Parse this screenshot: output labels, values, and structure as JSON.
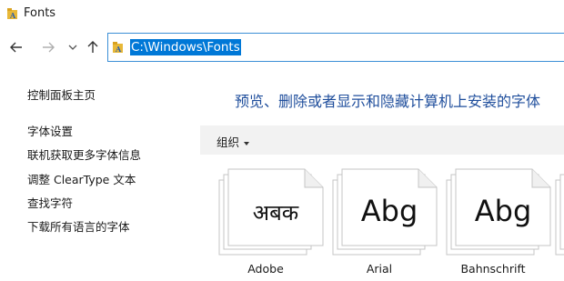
{
  "window": {
    "title": "Fonts"
  },
  "nav": {
    "back_icon": "arrow-left-icon",
    "forward_icon": "arrow-right-icon",
    "recent_icon": "chevron-down-icon",
    "up_icon": "arrow-up-icon"
  },
  "address": {
    "path": "C:\\Windows\\Fonts",
    "icon": "fonts-folder-icon"
  },
  "sidebar": {
    "items": [
      {
        "label": "控制面板主页"
      },
      {
        "label": "字体设置"
      },
      {
        "label": "联机获取更多字体信息"
      },
      {
        "label": "调整 ClearType 文本"
      },
      {
        "label": "查找字符"
      },
      {
        "label": "下载所有语言的字体"
      }
    ]
  },
  "main": {
    "heading": "预览、删除或者显示和隐藏计算机上安装的字体",
    "organize_label": "组织"
  },
  "fonts": [
    {
      "name": "Adobe",
      "sample": "अबक"
    },
    {
      "name": "Arial",
      "sample": "Abg"
    },
    {
      "name": "Bahnschrift",
      "sample": "Abg"
    }
  ],
  "colors": {
    "accent": "#0078d7",
    "heading": "#1f4e9c",
    "command_bar": "#f2f2f2",
    "folder": "#e8b838"
  }
}
